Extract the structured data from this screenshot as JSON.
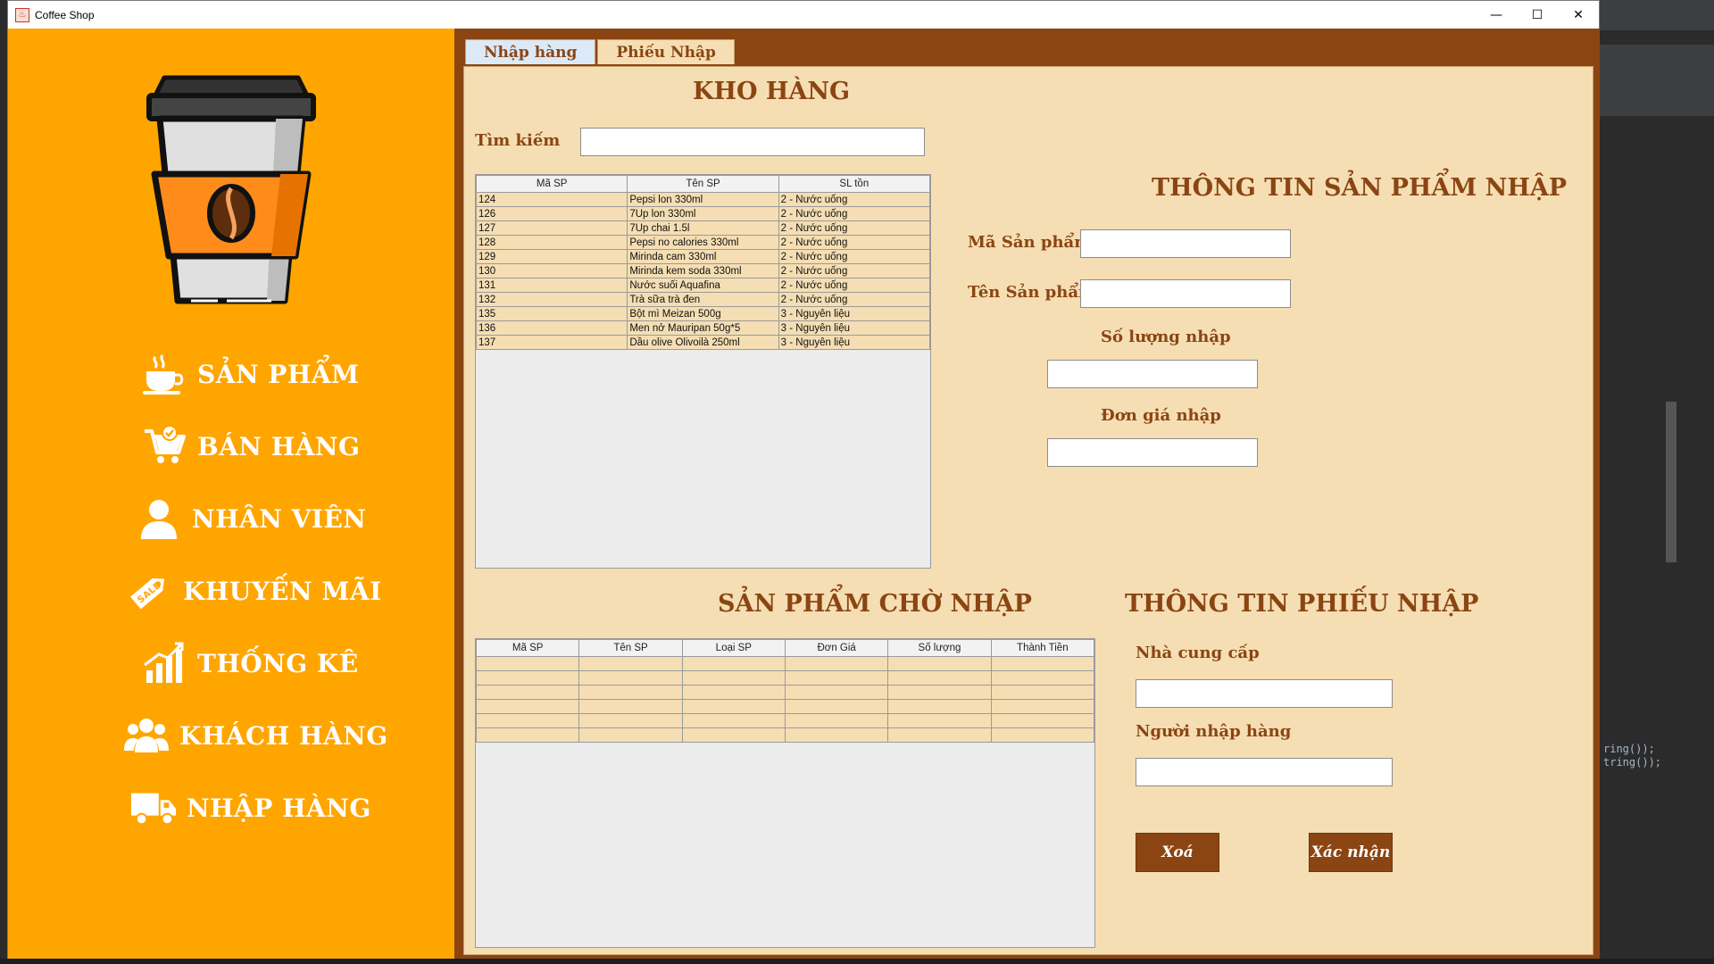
{
  "window": {
    "title": "Coffee Shop",
    "controls": {
      "minimize": "—",
      "maximize": "☐",
      "close": "✕"
    }
  },
  "sidebar": {
    "logo_icon": "coffee-cup-icon",
    "items": [
      {
        "label": "SẢN PHẨM",
        "icon": "coffee-icon"
      },
      {
        "label": "BÁN HÀNG",
        "icon": "cart-icon"
      },
      {
        "label": "NHÂN VIÊN",
        "icon": "user-icon"
      },
      {
        "label": "KHUYẾN MÃI",
        "icon": "sale-tag-icon"
      },
      {
        "label": "THỐNG KÊ",
        "icon": "chart-icon"
      },
      {
        "label": "KHÁCH HÀNG",
        "icon": "users-icon"
      },
      {
        "label": "NHẬP HÀNG",
        "icon": "truck-icon"
      }
    ],
    "colors": {
      "background": "#ffa500",
      "text": "#ffffff"
    }
  },
  "tabs": [
    {
      "label": "Nhập hàng",
      "active": true
    },
    {
      "label": "Phiếu Nhập",
      "active": false
    }
  ],
  "warehouse": {
    "title": "KHO HÀNG",
    "search_label": "Tìm kiếm",
    "search_value": "",
    "columns": [
      "Mã SP",
      "Tên SP",
      "SL tồn"
    ],
    "rows": [
      [
        "124",
        "Pepsi lon 330ml",
        "2 - Nước uống"
      ],
      [
        "126",
        "7Up lon 330ml",
        "2 - Nước uống"
      ],
      [
        "127",
        "7Up chai 1.5l",
        "2 - Nước uống"
      ],
      [
        "128",
        "Pepsi no calories 330ml",
        "2 - Nước uống"
      ],
      [
        "129",
        "Mirinda cam 330ml",
        "2 - Nước uống"
      ],
      [
        "130",
        "Mirinda kem soda 330ml",
        "2 - Nước uống"
      ],
      [
        "131",
        "Nước suối Aquafina",
        "2 - Nước uống"
      ],
      [
        "132",
        "Trà sữa trà đen",
        "2 - Nước uống"
      ],
      [
        "135",
        "Bột mì Meizan 500g",
        "3 - Nguyên liệu"
      ],
      [
        "136",
        "Men nở Mauripan 50g*5",
        "3 - Nguyên liệu"
      ],
      [
        "137",
        "Dầu olive Olivoilà 250ml",
        "3 - Nguyên liệu"
      ]
    ]
  },
  "product_info": {
    "title": "THÔNG TIN SẢN PHẨM NHẬP",
    "ma_sp_label": "Mã Sản phẩm",
    "ma_sp_value": "",
    "ten_sp_label": "Tên Sản phẩm",
    "ten_sp_value": "",
    "so_luong_label": "Số lượng nhập",
    "so_luong_value": "",
    "don_gia_label": "Đơn giá nhập",
    "don_gia_value": ""
  },
  "pending": {
    "title": "SẢN PHẨM CHỜ NHẬP",
    "columns": [
      "Mã SP",
      "Tên SP",
      "Loại SP",
      "Đơn Giá",
      "Số lượng",
      "Thành Tiền"
    ],
    "rows": [
      [
        "",
        "",
        "",
        "",
        "",
        ""
      ],
      [
        "",
        "",
        "",
        "",
        "",
        ""
      ],
      [
        "",
        "",
        "",
        "",
        "",
        ""
      ],
      [
        "",
        "",
        "",
        "",
        "",
        ""
      ],
      [
        "",
        "",
        "",
        "",
        "",
        ""
      ],
      [
        "",
        "",
        "",
        "",
        "",
        ""
      ]
    ]
  },
  "receipt_info": {
    "title": "THÔNG TIN PHIẾU NHẬP",
    "supplier_label": "Nhà cung cấp",
    "supplier_value": "",
    "importer_label": "Người nhập hàng",
    "importer_value": "",
    "delete_label": "Xoá",
    "confirm_label": "Xác nhận"
  },
  "ide_background": {
    "code_lines": [
      "ring());",
      "tring());"
    ]
  },
  "colors": {
    "brown": "#8b4513",
    "panel": "#f5deb3",
    "orange": "#ffa500"
  }
}
